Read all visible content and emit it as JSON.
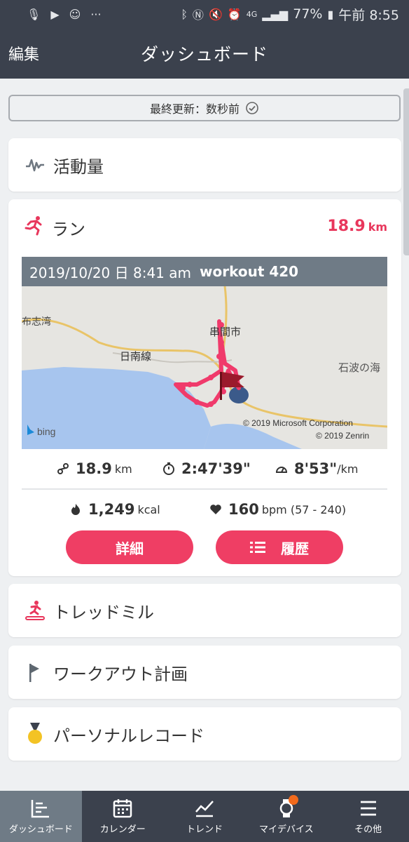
{
  "status_bar": {
    "battery": "77%",
    "time": "午前 8:55",
    "network": "4G",
    "icons": [
      "mic-icon",
      "play-store-icon",
      "face-icon",
      "more-icon",
      "bluetooth-icon",
      "nfc-icon",
      "mute-icon",
      "alarm-icon",
      "signal-icon",
      "battery-icon"
    ]
  },
  "app_bar": {
    "edit_label": "編集",
    "title": "ダッシュボード"
  },
  "update_bar": {
    "label": "最終更新：数秒前"
  },
  "cards": {
    "activity": {
      "label": "活動量",
      "icon": "activity-wave-icon"
    },
    "run": {
      "label": "ラン",
      "icon": "runner-icon",
      "distance_value": "18.9",
      "distance_unit": "km",
      "workout_date": "2019/10/20 日 8:41 am",
      "workout_name": "workout 420",
      "map": {
        "labels": [
          "日南線",
          "布志湾",
          "串間市",
          "石波の海"
        ],
        "attribution_1": "© 2019 Microsoft Corporation",
        "attribution_2": "© 2019 Zenrin",
        "provider": "bing"
      },
      "stats": {
        "distance": "18.9",
        "distance_unit": "km",
        "duration": "2:47'39\"",
        "pace": "8'53\"",
        "pace_unit": "/km",
        "calories": "1,249",
        "calories_unit": "kcal",
        "heart_rate": "160",
        "heart_rate_unit": "bpm (57 - 240)"
      },
      "details_button": "詳細",
      "history_button": "履歴"
    },
    "treadmill": {
      "label": "トレッドミル",
      "icon": "treadmill-icon"
    },
    "workout_plan": {
      "label": "ワークアウト計画",
      "icon": "flag-icon"
    },
    "personal_record": {
      "label": "パーソナルレコード",
      "icon": "medal-icon"
    }
  },
  "bottom_nav": {
    "items": [
      {
        "label": "ダッシュボード",
        "icon": "dashboard-icon",
        "active": true
      },
      {
        "label": "カレンダー",
        "icon": "calendar-icon",
        "active": false
      },
      {
        "label": "トレンド",
        "icon": "trend-icon",
        "active": false
      },
      {
        "label": "マイデバイス",
        "icon": "watch-icon",
        "active": false
      },
      {
        "label": "その他",
        "icon": "menu-icon",
        "active": false
      }
    ]
  },
  "colors": {
    "app_bar": "#3b414d",
    "accent": "#e8375c",
    "button": "#ef3e64",
    "workout_header": "#6f7b86",
    "background": "#eef0f2"
  }
}
